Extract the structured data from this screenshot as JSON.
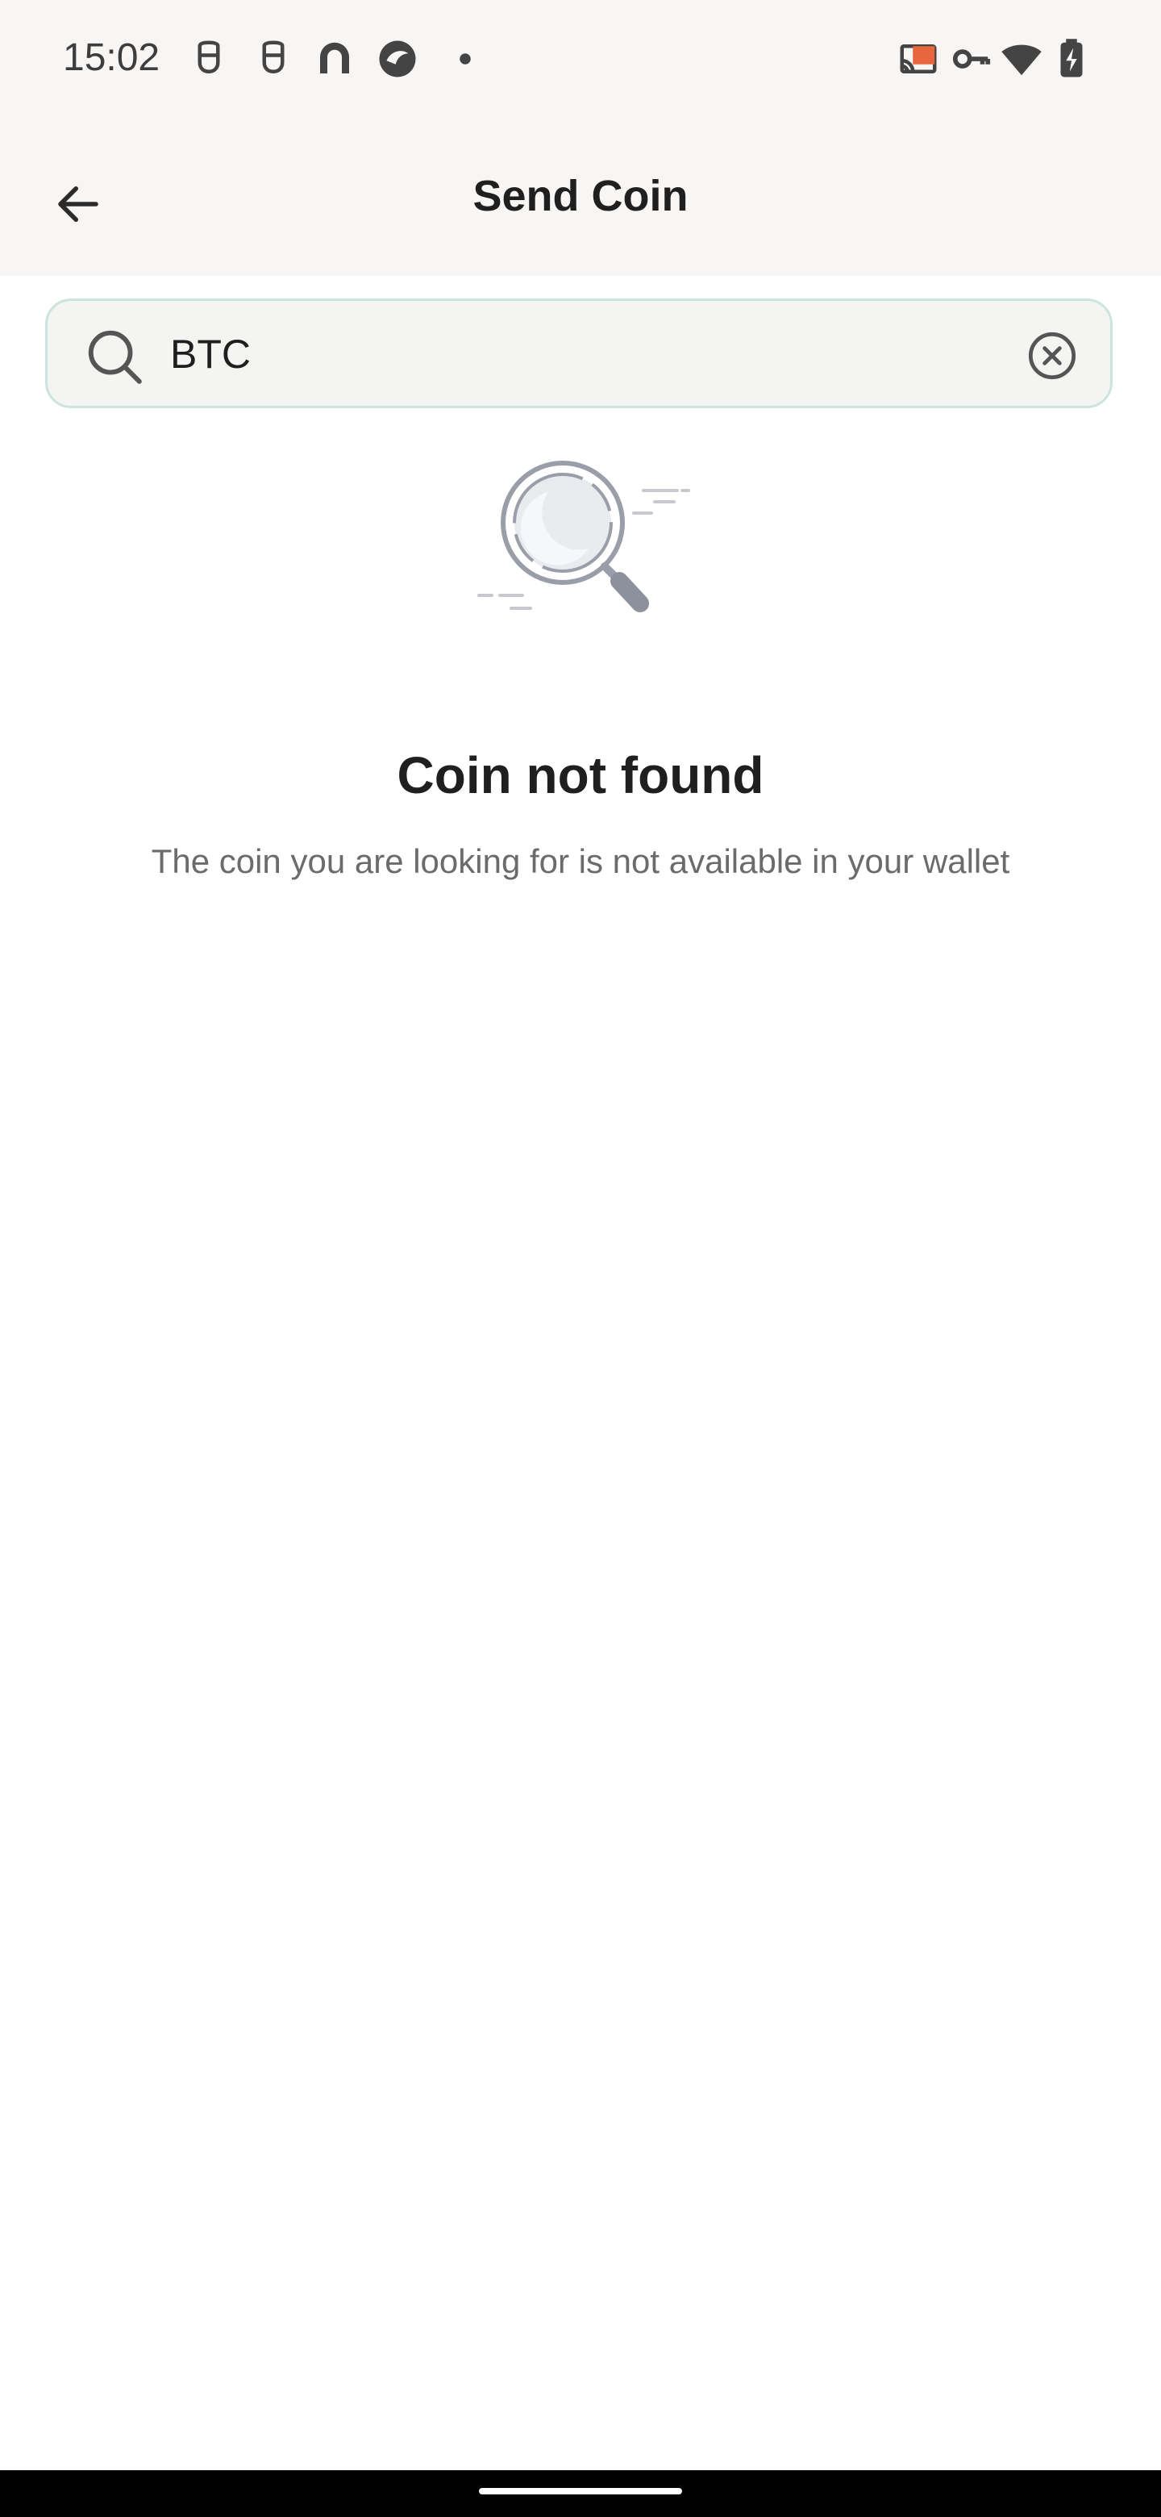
{
  "status_bar": {
    "time": "15:02",
    "left_icons": [
      "notification-icon",
      "notification-icon",
      "app-icon",
      "app-icon",
      "dot-icon"
    ],
    "right_icons": [
      "cast-icon",
      "key-icon",
      "wifi-icon",
      "battery-charging-icon"
    ],
    "cast_color": "#e8663d"
  },
  "header": {
    "title": "Send Coin",
    "back_icon": "arrow-left-icon"
  },
  "search": {
    "value": "BTC",
    "icon": "search-icon",
    "clear_icon": "close-circle-icon"
  },
  "empty_state": {
    "illustration": "magnifier-illustration",
    "title": "Coin not found",
    "description": "The coin you are looking for is not available in your wallet"
  },
  "colors": {
    "header_bg": "#f7f6f4",
    "search_border": "#cbe4e0",
    "search_bg": "#f4f4f2",
    "title_text": "#1f1f1f",
    "secondary_text": "#6b6b6b"
  }
}
